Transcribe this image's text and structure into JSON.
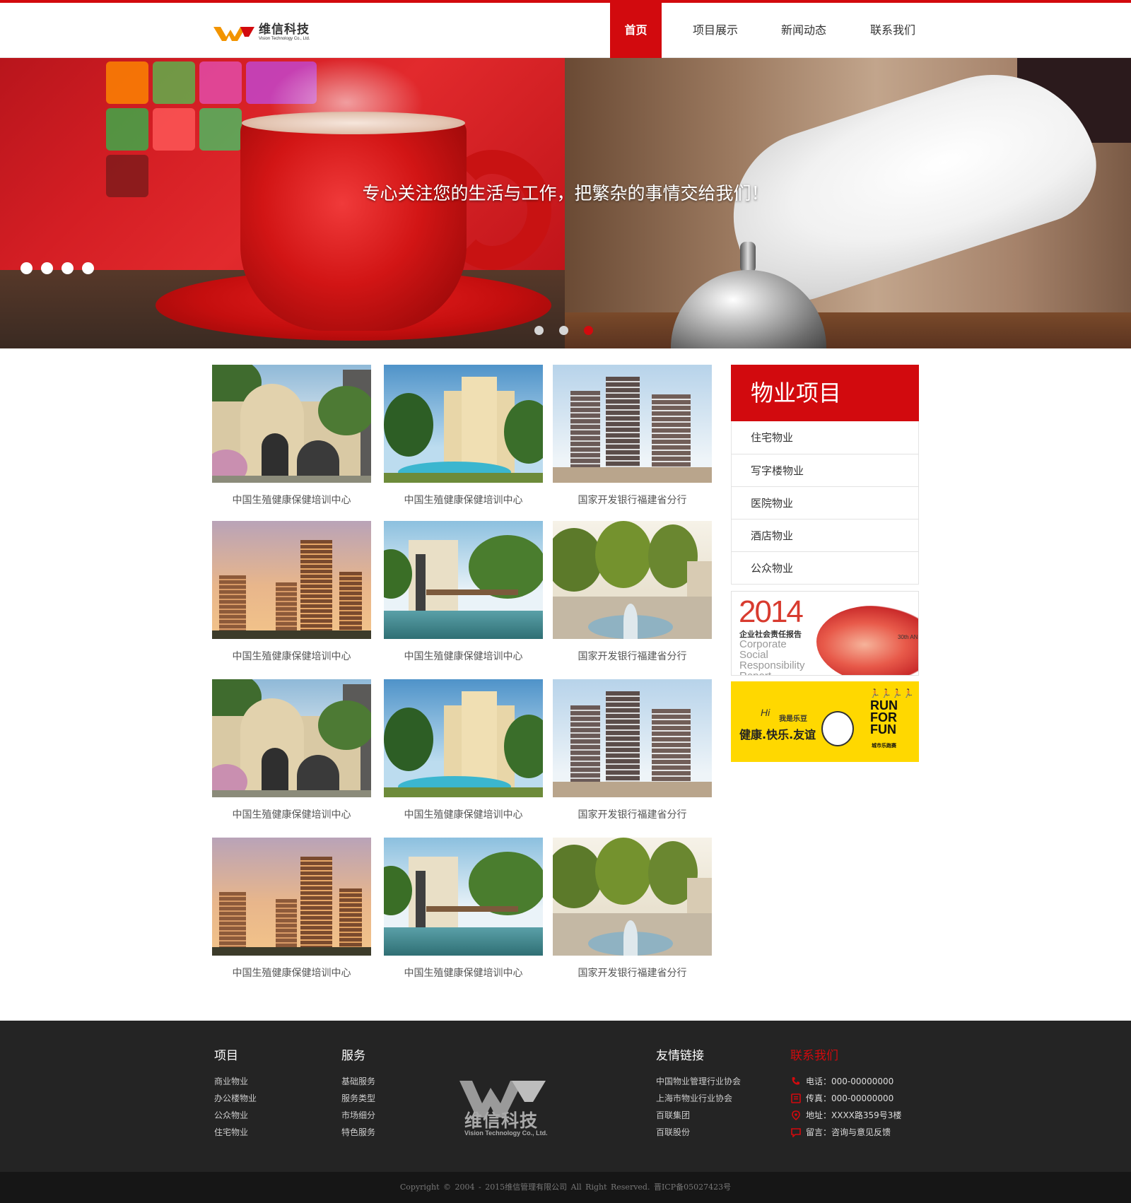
{
  "brand": {
    "name_cn": "维信科技",
    "name_en": "Vision Technology Co., Ltd.",
    "accent_color": "#d20a0e"
  },
  "nav": {
    "items": [
      {
        "label": "首页",
        "active": true
      },
      {
        "label": "项目展示",
        "active": false
      },
      {
        "label": "新闻动态",
        "active": false
      },
      {
        "label": "联系我们",
        "active": false
      }
    ]
  },
  "banner": {
    "caption": "专心关注您的生活与工作，把繁杂的事情交给我们！",
    "slide_count": 3,
    "active_slide": 3
  },
  "projects": [
    {
      "caption": "中国生殖健康保健培训中心",
      "image": "gatehouse"
    },
    {
      "caption": "中国生殖健康保健培训中心",
      "image": "villa-pool"
    },
    {
      "caption": "国家开发银行福建省分行",
      "image": "highrise-towers"
    },
    {
      "caption": "中国生殖健康保健培训中心",
      "image": "sunset-towers"
    },
    {
      "caption": "中国生殖健康保健培训中心",
      "image": "pergola-pond"
    },
    {
      "caption": "国家开发银行福建省分行",
      "image": "plaza-fountain"
    },
    {
      "caption": "中国生殖健康保健培训中心",
      "image": "gatehouse"
    },
    {
      "caption": "中国生殖健康保健培训中心",
      "image": "villa-pool"
    },
    {
      "caption": "国家开发银行福建省分行",
      "image": "highrise-towers"
    },
    {
      "caption": "中国生殖健康保健培训中心",
      "image": "sunset-towers"
    },
    {
      "caption": "中国生殖健康保健培训中心",
      "image": "pergola-pond"
    },
    {
      "caption": "国家开发银行福建省分行",
      "image": "plaza-fountain"
    }
  ],
  "sidebar": {
    "title": "物业项目",
    "items": [
      {
        "label": "住宅物业"
      },
      {
        "label": "写字楼物业"
      },
      {
        "label": "医院物业"
      },
      {
        "label": "酒店物业"
      },
      {
        "label": "公众物业"
      }
    ],
    "ad_report": {
      "year": "2014",
      "title_cn": "企业社会责任报告",
      "title_en": "Corporate Social Responsibility Report",
      "tag": "30th AN"
    },
    "ad_run": {
      "hi": "Hi",
      "small": "我是乐豆",
      "slogan": "健康.快乐.友谊",
      "run_lines": [
        "RUN",
        "FOR",
        "FUN"
      ],
      "sub": "城市乐跑赛"
    }
  },
  "footer": {
    "projects": {
      "title": "项目",
      "links": [
        "商业物业",
        "办公楼物业",
        "公众物业",
        "住宅物业"
      ]
    },
    "services": {
      "title": "服务",
      "links": [
        "基础服务",
        "服务类型",
        "市场细分",
        "特色服务"
      ]
    },
    "friends": {
      "title": "友情链接",
      "links": [
        "中国物业管理行业协会",
        "上海市物业行业协会",
        "百联集团",
        "百联股份"
      ]
    },
    "contact": {
      "title": "联系我们",
      "phone": "电话：000-00000000",
      "fax": "传真：000-00000000",
      "address": "地址：XXXX路359号3楼",
      "message": "留言：咨询与意见反馈"
    },
    "copyright": "Copyright © 2004 - 2015维信管理有限公司  All Right Reserved.   晋ICP备05027423号"
  }
}
